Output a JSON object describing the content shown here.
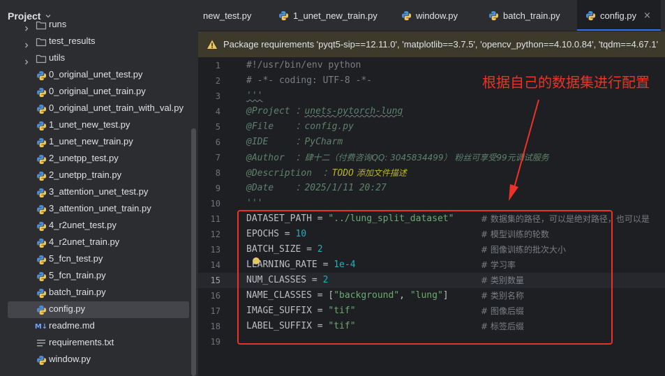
{
  "project": {
    "title": "Project",
    "tree": [
      {
        "kind": "folder",
        "label": "runs",
        "expandable": true
      },
      {
        "kind": "folder",
        "label": "test_results",
        "expandable": true
      },
      {
        "kind": "folder",
        "label": "utils",
        "expandable": true
      },
      {
        "kind": "py",
        "label": "0_original_unet_test.py"
      },
      {
        "kind": "py",
        "label": "0_original_unet_train.py"
      },
      {
        "kind": "py",
        "label": "0_original_unet_train_with_val.py"
      },
      {
        "kind": "py",
        "label": "1_unet_new_test.py"
      },
      {
        "kind": "py",
        "label": "1_unet_new_train.py"
      },
      {
        "kind": "py",
        "label": "2_unetpp_test.py"
      },
      {
        "kind": "py",
        "label": "2_unetpp_train.py"
      },
      {
        "kind": "py",
        "label": "3_attention_unet_test.py"
      },
      {
        "kind": "py",
        "label": "3_attention_unet_train.py"
      },
      {
        "kind": "py",
        "label": "4_r2unet_test.py"
      },
      {
        "kind": "py",
        "label": "4_r2unet_train.py"
      },
      {
        "kind": "py",
        "label": "5_fcn_test.py"
      },
      {
        "kind": "py",
        "label": "5_fcn_train.py"
      },
      {
        "kind": "py",
        "label": "batch_train.py"
      },
      {
        "kind": "py",
        "label": "config.py",
        "selected": true
      },
      {
        "kind": "md",
        "label": "readme.md",
        "badge": "M↓"
      },
      {
        "kind": "txt",
        "label": "requirements.txt"
      },
      {
        "kind": "py",
        "label": "window.py"
      }
    ]
  },
  "tabs": [
    {
      "label": "new_test.py",
      "icon": false,
      "active": false
    },
    {
      "label": "1_unet_new_train.py",
      "icon": true,
      "active": false
    },
    {
      "label": "window.py",
      "icon": true,
      "active": false
    },
    {
      "label": "batch_train.py",
      "icon": true,
      "active": false
    },
    {
      "label": "config.py",
      "icon": true,
      "active": true,
      "close": "×"
    }
  ],
  "notice": {
    "text": "Package requirements 'pyqt5-sip==12.11.0', 'matplotlib==3.7.5', 'opencv_python==4.10.0.84', 'tqdm==4.67.1'"
  },
  "editor": {
    "line_numbers": [
      "1",
      "2",
      "3",
      "4",
      "5",
      "6",
      "7",
      "8",
      "9",
      "10",
      "11",
      "12",
      "13",
      "14",
      "15",
      "16",
      "17",
      "18",
      "19"
    ],
    "current_line": "15",
    "code": {
      "shebang": "#!/usr/bin/env python",
      "coding": "# -*- coding: UTF-8 -*-",
      "doc_open": "'''",
      "project_key": "@Project ：",
      "project_val": "unets-pytorch-lung",
      "file_key": "@File    ：",
      "file_val": "config.py",
      "ide_key": "@IDE     ：",
      "ide_val": "PyCharm",
      "author_key": "@Author  ：",
      "author_val": "肆十二（付费咨询QQ: 3045834499） 粉丝可享受99元调试服务",
      "desc_key": "@Description  ：",
      "desc_todo": "TODO",
      "desc_val": " 添加文件描述",
      "date_key": "@Date    ：",
      "date_val": "2025/1/11 20:27",
      "doc_close": "'''",
      "l11_name": "DATASET_PATH = ",
      "l11_val": "\"../lung_split_dataset\"",
      "l12_name": "EPOCHS = ",
      "l12_val": "10",
      "l13_name": "BATCH_SIZE = ",
      "l13_val": "2",
      "l14_name": "LEARNING_RATE = ",
      "l14_val": "1e-4",
      "l15_name": "NUM_CLASSES = ",
      "l15_val": "2",
      "l16_name": "NAME_CLASSES = [",
      "l16_v1": "\"background\"",
      "l16_sep": ", ",
      "l16_v2": "\"lung\"",
      "l16_end": "]",
      "l17_name": "IMAGE_SUFFIX = ",
      "l17_val": "\"tif\"",
      "l18_name": "LABEL_SUFFIX = ",
      "l18_val": "\"tif\""
    },
    "comments": [
      "# 数据集的路径，可以是绝对路径，也可以是",
      "# 模型训练的轮数",
      "# 图像训练的批次大小",
      "# 学习率",
      "# 类别数量",
      "# 类别名称",
      "# 图像后缀",
      "# 标签后缀"
    ]
  },
  "annotation": {
    "text": "根据自己的数据集进行配置",
    "color": "#ee3228"
  }
}
